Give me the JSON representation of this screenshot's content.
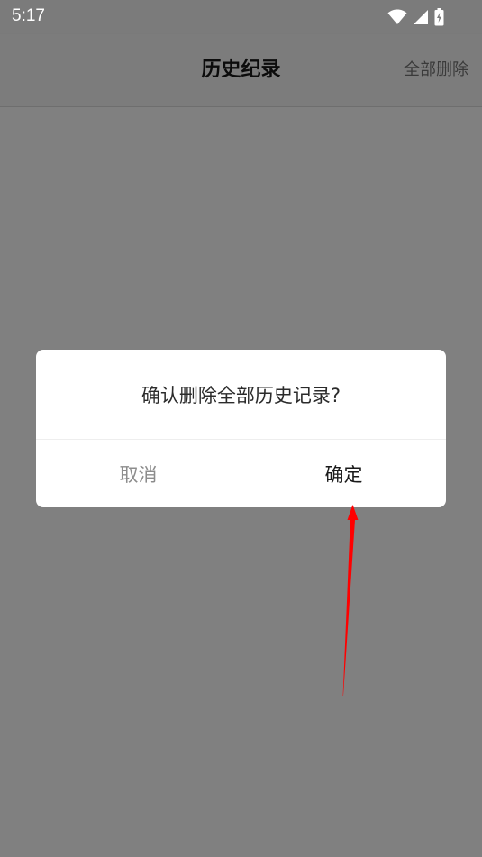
{
  "status_bar": {
    "time": "5:17",
    "icons": [
      "wifi-icon",
      "cell-signal-icon",
      "battery-charging-icon"
    ]
  },
  "app_bar": {
    "title": "历史纪录",
    "action_label": "全部删除"
  },
  "dialog": {
    "message": "确认删除全部历史记录?",
    "cancel_label": "取消",
    "confirm_label": "确定"
  },
  "annotation": {
    "type": "arrow",
    "color": "#ff0000",
    "points_to": "confirm-button"
  },
  "colors": {
    "scrim": "#808080",
    "dialog_background": "#ffffff",
    "cancel_text": "#8c8c8c",
    "confirm_text": "#1a1a1a",
    "arrow": "#ff0000"
  }
}
